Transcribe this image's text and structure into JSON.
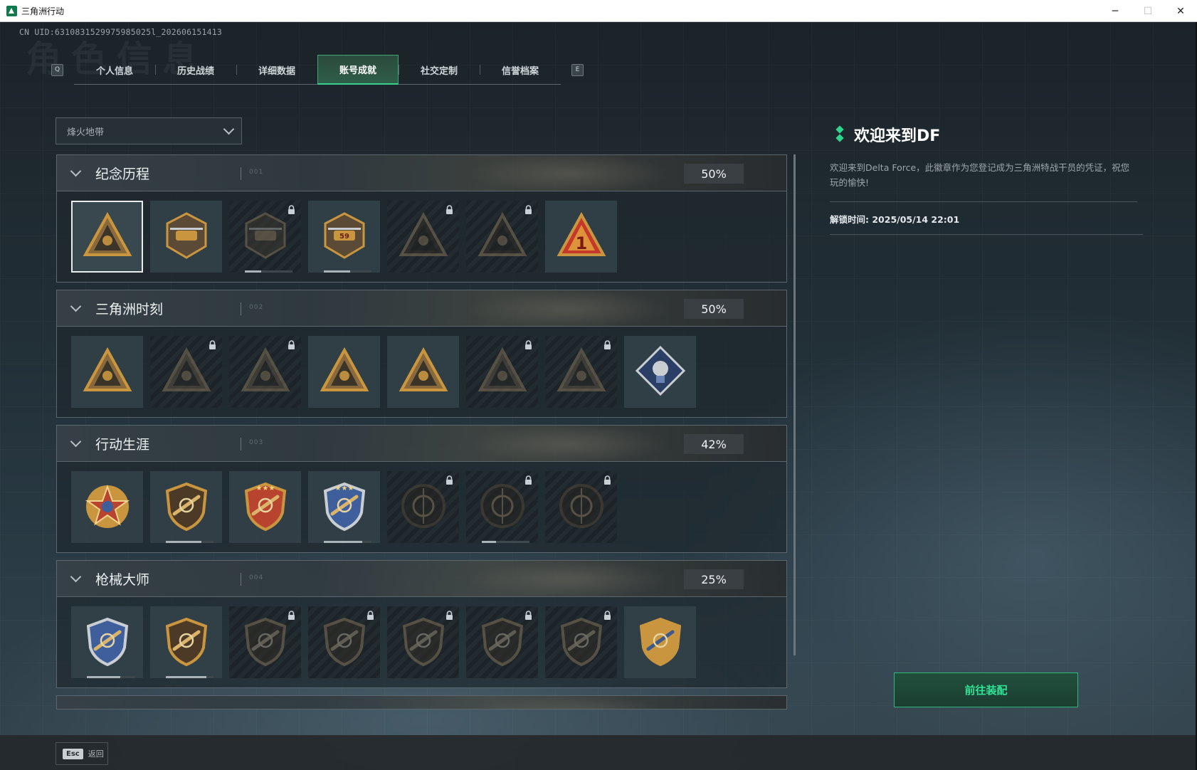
{
  "window": {
    "title": "三角洲行动",
    "minimize": "─",
    "maximize": "☐",
    "close": "✕"
  },
  "uid": "CN UID:6310831529975985025l_202606151413",
  "ghost_title": "角色信息",
  "tabs": {
    "left_key": "Q",
    "right_key": "E",
    "items": [
      {
        "label": "个人信息"
      },
      {
        "label": "历史战绩"
      },
      {
        "label": "详细数据"
      },
      {
        "label": "账号成就",
        "active": true
      },
      {
        "label": "社交定制"
      },
      {
        "label": "信誉档案"
      }
    ]
  },
  "mode_select": {
    "value": "烽火地带"
  },
  "sections": [
    {
      "name": "纪念历程",
      "percent": "50%",
      "mark": "001",
      "badges": [
        {
          "icon": "delta-triangle-hex-icon",
          "locked": false,
          "selected": true
        },
        {
          "icon": "helicopter-icon",
          "locked": false,
          "progress": 0
        },
        {
          "icon": "hex-shield-icon",
          "locked": true,
          "progress": 0.35
        },
        {
          "icon": "tank-59-icon",
          "locked": false,
          "progress": 0.55
        },
        {
          "icon": "hooded-operator-icon",
          "locked": true
        },
        {
          "icon": "crossed-rifles-skull-icon",
          "locked": true
        },
        {
          "icon": "red-number-one-icon",
          "locked": false
        }
      ]
    },
    {
      "name": "三角洲时刻",
      "percent": "50%",
      "mark": "002",
      "badges": [
        {
          "icon": "usb-drive-triangle-icon",
          "locked": false
        },
        {
          "icon": "goblet-triangle-icon",
          "locked": true
        },
        {
          "icon": "kneeling-soldier-icon",
          "locked": true
        },
        {
          "icon": "hands-crystal-icon",
          "locked": false
        },
        {
          "icon": "carrying-soldier-icon",
          "locked": false
        },
        {
          "icon": "squad-triangle-icon",
          "locked": true
        },
        {
          "icon": "fish-triangle-icon",
          "locked": true
        },
        {
          "icon": "trophy-diamond-icon",
          "locked": false
        }
      ]
    },
    {
      "name": "行动生涯",
      "percent": "42%",
      "mark": "003",
      "badges": [
        {
          "icon": "star-wreath-medal-icon",
          "locked": false
        },
        {
          "icon": "chevron-shield-icon",
          "locked": false,
          "progress": 0.75
        },
        {
          "icon": "red-gold-shield-icon",
          "locked": false
        },
        {
          "icon": "blue-star-shield-icon",
          "locked": false,
          "progress": 0.8
        },
        {
          "icon": "ring-circle-icon",
          "locked": true
        },
        {
          "icon": "skull-crosshair-icon",
          "locked": true,
          "progress": 0.3
        },
        {
          "icon": "eye-circle-icon",
          "locked": true
        }
      ]
    },
    {
      "name": "枪械大师",
      "percent": "25%",
      "mark": "004",
      "badges": [
        {
          "icon": "crosshair-blue-shield-icon",
          "locked": false,
          "progress": 0.7
        },
        {
          "icon": "rifle-shield-icon",
          "locked": false,
          "progress": 0.85
        },
        {
          "icon": "smg-shield-icon",
          "locked": true
        },
        {
          "icon": "assault-rifle-shield-icon",
          "locked": true
        },
        {
          "icon": "shotgun-shield-icon",
          "locked": true
        },
        {
          "icon": "sniper-shield-icon",
          "locked": true
        },
        {
          "icon": "pistol-shield-icon",
          "locked": true
        },
        {
          "icon": "gold-crossed-guns-icon",
          "locked": false
        }
      ]
    }
  ],
  "detail": {
    "title": "欢迎来到DF",
    "description": "欢迎来到Delta Force，此徽章作为您登记成为三角洲特战干员的凭证，祝您玩的愉快!",
    "unlock_time": "解锁时间: 2025/05/14 22:01"
  },
  "equip_button": "前往装配",
  "back": {
    "key": "Esc",
    "label": "返回"
  },
  "colors": {
    "accent": "#2fd48d",
    "locked": "#1c2429",
    "panel": "#34424a"
  }
}
